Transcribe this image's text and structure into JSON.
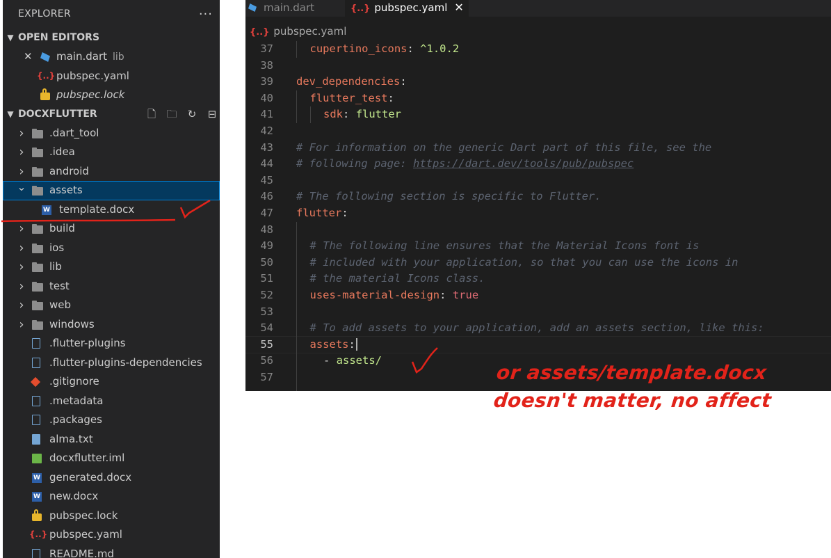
{
  "explorer": {
    "title": "EXPLORER",
    "more_icon": "ellipsis-icon",
    "open_editors": {
      "header": "OPEN EDITORS",
      "items": [
        {
          "label": "main.dart",
          "hint": "lib",
          "icon": "dart-file-icon"
        },
        {
          "label": "pubspec.yaml",
          "icon": "yaml-file-icon"
        },
        {
          "label": "pubspec.lock",
          "icon": "lock-file-icon"
        }
      ]
    },
    "workspace": {
      "header": "DOCXFLUTTER",
      "actions": [
        "new-file-icon",
        "new-folder-icon",
        "refresh-icon",
        "collapse-all-icon"
      ],
      "items": [
        {
          "label": ".dart_tool",
          "type": "folder"
        },
        {
          "label": ".idea",
          "type": "folder"
        },
        {
          "label": "android",
          "type": "folder"
        },
        {
          "label": "assets",
          "type": "folder",
          "expanded": true,
          "selected": true
        },
        {
          "label": "template.docx",
          "type": "docx"
        },
        {
          "label": "build",
          "type": "folder"
        },
        {
          "label": "ios",
          "type": "folder"
        },
        {
          "label": "lib",
          "type": "folder"
        },
        {
          "label": "test",
          "type": "folder"
        },
        {
          "label": "web",
          "type": "folder"
        },
        {
          "label": "windows",
          "type": "folder"
        },
        {
          "label": ".flutter-plugins",
          "type": "file"
        },
        {
          "label": ".flutter-plugins-dependencies",
          "type": "file"
        },
        {
          "label": ".gitignore",
          "type": "git"
        },
        {
          "label": ".metadata",
          "type": "file"
        },
        {
          "label": ".packages",
          "type": "file"
        },
        {
          "label": "alma.txt",
          "type": "txt"
        },
        {
          "label": "docxflutter.iml",
          "type": "xml"
        },
        {
          "label": "generated.docx",
          "type": "docx"
        },
        {
          "label": "new.docx",
          "type": "docx"
        },
        {
          "label": "pubspec.lock",
          "type": "lock"
        },
        {
          "label": "pubspec.yaml",
          "type": "yaml"
        },
        {
          "label": "README.md",
          "type": "md"
        }
      ]
    }
  },
  "editor": {
    "tabs": [
      {
        "label": "main.dart",
        "active": false
      },
      {
        "label": "pubspec.yaml",
        "active": true,
        "close": "✕"
      }
    ],
    "breadcrumb": "pubspec.yaml",
    "yaml_icon_text": "{..}",
    "lines": [
      {
        "n": "37",
        "key": "cupertino_icons",
        "value": "^1.0.2"
      },
      {
        "n": "38"
      },
      {
        "n": "39",
        "key": "dev_dependencies"
      },
      {
        "n": "40",
        "key": "flutter_test"
      },
      {
        "n": "41",
        "key": "sdk",
        "value": "flutter"
      },
      {
        "n": "42"
      },
      {
        "n": "43",
        "comment": "# For information on the generic Dart part of this file, see the"
      },
      {
        "n": "44",
        "comment": "# following page: ",
        "link": "https://dart.dev/tools/pub/pubspec"
      },
      {
        "n": "45"
      },
      {
        "n": "46",
        "comment": "# The following section is specific to Flutter."
      },
      {
        "n": "47",
        "key": "flutter"
      },
      {
        "n": "48"
      },
      {
        "n": "49",
        "comment": "# The following line ensures that the Material Icons font is"
      },
      {
        "n": "50",
        "comment": "# included with your application, so that you can use the icons in"
      },
      {
        "n": "51",
        "comment": "# the material Icons class."
      },
      {
        "n": "52",
        "key": "uses-material-design",
        "value": "true"
      },
      {
        "n": "53"
      },
      {
        "n": "54",
        "comment": "# To add assets to your application, add an assets section, like this:"
      },
      {
        "n": "55",
        "key": "assets"
      },
      {
        "n": "56",
        "item": "assets/"
      },
      {
        "n": "57"
      }
    ]
  },
  "annotation": {
    "line1": "or assets/template.docx",
    "line2": "doesn't matter, no affect",
    "color": "#e2231a"
  }
}
